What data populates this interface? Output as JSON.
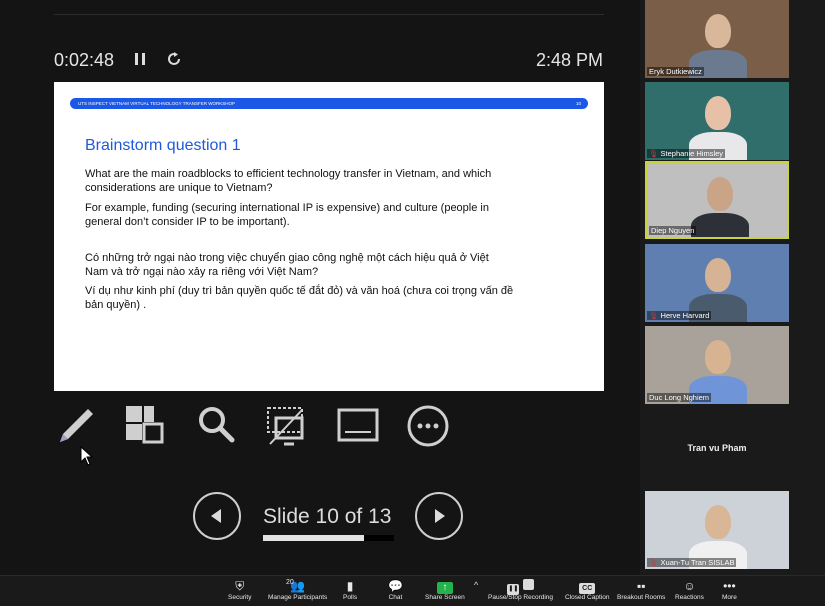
{
  "presenter": {
    "elapsed": "0:02:48",
    "clock": "2:48 PM",
    "pause_icon": "pause-icon",
    "reload_icon": "rotate-icon"
  },
  "slide": {
    "header": "UTS INSPECT VIETNAM  VIRTUAL TECHNOLOGY TRANSFER WORKSHOP",
    "header_num": "10",
    "title": "Brainstorm question 1",
    "p1": "What are the main roadblocks to efficient technology transfer in Vietnam, and which considerations are unique to Vietnam?",
    "p2": "For example, funding (securing international IP is expensive) and culture (people in general don’t consider IP to be important).",
    "p3": "Có những trở ngại nào trong việc chuyển giao công nghệ một cách hiệu quả ở Việt Nam và trở ngại nào xảy ra riêng với Việt Nam?",
    "p4": "Ví dụ như kinh phí (duy trì bản quyền quốc tế đắt đỏ) và văn hoá (chưa coi trọng vấn đề bản quyền) ."
  },
  "tools": [
    "pen-icon",
    "layout-icon",
    "magnify-icon",
    "crop-screen-icon",
    "subtitle-icon",
    "more-icon"
  ],
  "navigation": {
    "counter": "Slide 10 of 13",
    "progress": 0.77,
    "prev_icon": "prev-arrow-icon",
    "next_icon": "next-arrow-icon"
  },
  "participants": [
    {
      "name": "Eryk Dutkiewicz",
      "muted": false,
      "bg": "#7a5e48",
      "skin": "#d9b79b",
      "shirt": "#6b7a8f"
    },
    {
      "name": "Stephanie Himsley",
      "muted": true,
      "bg": "#2f6e6a",
      "skin": "#e7c0a8",
      "shirt": "#e8e8ea"
    },
    {
      "name": "Diep Nguyen",
      "muted": false,
      "bg": "#bfbfc0",
      "skin": "#caa487",
      "shirt": "#2e3038",
      "active": true
    },
    {
      "name": "Herve Harvard",
      "muted": true,
      "bg": "#5f7fb0",
      "skin": "#d7b395",
      "shirt": "#4a5b6e"
    },
    {
      "name": "Duc Long Nghiem",
      "muted": false,
      "bg": "#a8a29a",
      "skin": "#d7b391",
      "shirt": "#6f95d8"
    },
    {
      "name": "Tran vu Pham",
      "muted": false,
      "text_only": true
    },
    {
      "name": "Xuan-Tu Tran SISLAB",
      "muted": true,
      "bg": "#cdd2d8",
      "skin": "#d8b696",
      "shirt": "#f0f0f0"
    }
  ],
  "taskbar": {
    "participants_count": "20",
    "items": [
      {
        "label": "Security",
        "icon": "shield-icon",
        "glyph": "⛨"
      },
      {
        "label": "Manage Participants",
        "icon": "people-icon",
        "glyph": "👥"
      },
      {
        "label": "Polls",
        "icon": "polls-icon",
        "glyph": "▮"
      },
      {
        "label": "Chat",
        "icon": "chat-icon",
        "glyph": "💬"
      },
      {
        "label": "Share Screen",
        "icon": "share-screen-icon",
        "glyph": "↑"
      },
      {
        "label": "Pause/Stop Recording",
        "icon": "record-icon",
        "glyph": "❚❚"
      },
      {
        "label": "Closed Caption",
        "icon": "cc-icon",
        "glyph": "CC"
      },
      {
        "label": "Breakout Rooms",
        "icon": "breakout-icon",
        "glyph": "▪▪"
      },
      {
        "label": "Reactions",
        "icon": "reactions-icon",
        "glyph": "☺"
      },
      {
        "label": "More",
        "icon": "more-dots-icon",
        "glyph": "•••"
      }
    ]
  },
  "colors": {
    "accent": "#1b58e8",
    "share_green": "#24b24a",
    "active_border": "#c9d43a"
  }
}
